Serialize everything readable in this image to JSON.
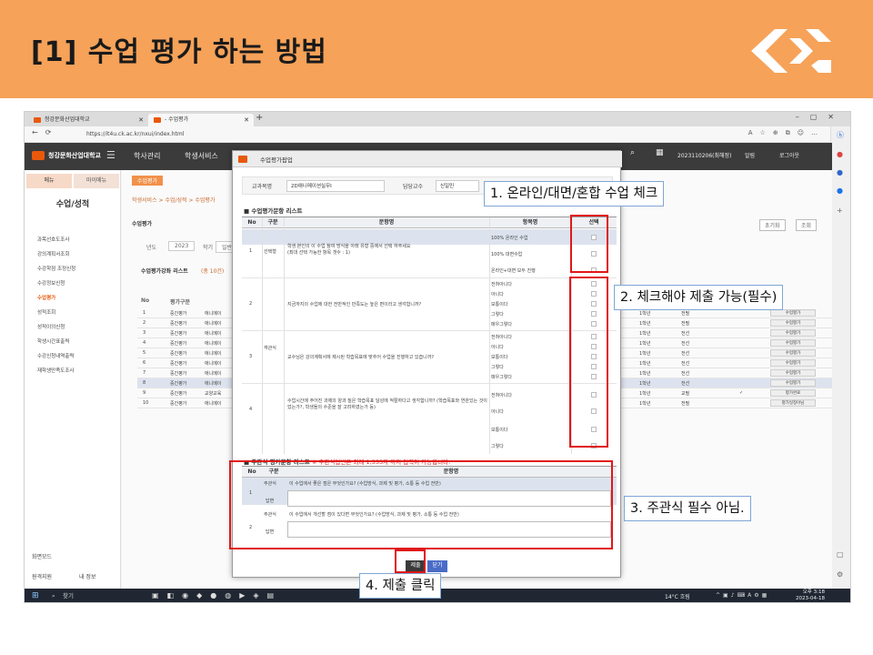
{
  "slide": {
    "title": "[1] 수업 평가 하는 방법"
  },
  "browser": {
    "tabs": [
      "청강문화산업대학교",
      "- 수업평가"
    ],
    "url": "https://it4u.ck.ac.kr/nxui/index.html"
  },
  "site": {
    "name": "청강문화산업대학교",
    "nav": [
      "학사관리",
      "학생서비스"
    ],
    "user": "2023110206(최해정)",
    "alarm": "알림",
    "logout": "로그아웃"
  },
  "leftpanel": {
    "tabs": [
      "메뉴",
      "마이메뉴"
    ],
    "section": "수업/성적",
    "items": [
      "과목선호도조사",
      "강의계획서조회",
      "수강학점 조정신청",
      "수강정보신청",
      "수업평가",
      "성적조회",
      "성적이의신청",
      "학생시간표출력",
      "수강신청내역출력",
      "재학생만족도조사"
    ],
    "bottom": [
      "화면모드",
      "원격지원",
      "내 정보"
    ]
  },
  "background": {
    "tab": "수업평가",
    "breadcrumb": "학생서비스 > 수업/성적 > 수업평가",
    "page_title": "수업평가",
    "year_label": "년도",
    "year_value": "2023",
    "term_label": "학기",
    "term_value": "일반",
    "list_title": "수업평가강좌 리스트",
    "list_count": "(총 10건)",
    "search_btn": "조회",
    "reset_btn": "초기화",
    "header_no": "No",
    "header_type": "평가구분",
    "rows": [
      {
        "no": "1",
        "type": "중간평가",
        "course": "애니메이",
        "grade": "1학년",
        "kind": "전필",
        "btn": "수업평가"
      },
      {
        "no": "2",
        "type": "중간평가",
        "course": "애니메이",
        "grade": "1학년",
        "kind": "전필",
        "btn": "수업평가"
      },
      {
        "no": "3",
        "type": "중간평가",
        "course": "애니메이",
        "grade": "1학년",
        "kind": "전선",
        "btn": "수업평가"
      },
      {
        "no": "4",
        "type": "중간평가",
        "course": "애니메이",
        "grade": "1학년",
        "kind": "전선",
        "btn": "수업평가"
      },
      {
        "no": "5",
        "type": "중간평가",
        "course": "애니메이",
        "grade": "1학년",
        "kind": "전선",
        "btn": "수업평가"
      },
      {
        "no": "6",
        "type": "중간평가",
        "course": "애니메이",
        "grade": "1학년",
        "kind": "전선",
        "btn": "수업평가"
      },
      {
        "no": "7",
        "type": "중간평가",
        "course": "애니메이",
        "grade": "1학년",
        "kind": "전선",
        "btn": "수업평가"
      },
      {
        "no": "8",
        "type": "중간평가",
        "course": "애니메이",
        "grade": "1학년",
        "kind": "전선",
        "btn": "수업평가"
      },
      {
        "no": "9",
        "type": "중간평가",
        "course": "교양교육",
        "grade": "1학년",
        "kind": "교필",
        "btn": "평가완료"
      },
      {
        "no": "10",
        "type": "중간평가",
        "course": "애니메이",
        "grade": "1학년",
        "kind": "전필",
        "btn": "평가일정아님"
      }
    ]
  },
  "popup": {
    "title": "수업평가팝업",
    "course_label": "교과목명",
    "course_value": "2D애니메이션실무Ⅰ",
    "prof_label": "담당교수",
    "prof_value": "신일민",
    "obj_title": "수업평가문항 리스트",
    "headers": {
      "no": "No",
      "type": "구분",
      "question": "문항명",
      "item": "항목명",
      "select": "선택"
    },
    "group_choice": "선택형",
    "group_obj": "객관식",
    "questions": [
      {
        "no": "1",
        "text": "학생 본인의 이 수업 참여 방식을 아래 유형 중에서 선택 하주세요",
        "sub": "(최대 선택 가능한 항목 갯수 : 1)",
        "options": [
          "100% 온라인 수업",
          "100% 대면수업",
          "온라인+대면 모두 진행"
        ]
      },
      {
        "no": "2",
        "text": "지금까지의 수업에 대한 전반적인 만족도는 높은 편이라고 생각합니까?",
        "sub": "",
        "options": [
          "전혀아니다",
          "아니다",
          "보통이다",
          "그렇다",
          "매우그렇다"
        ]
      },
      {
        "no": "3",
        "text": "교수님은 강의계획서에 제시된 학습목표에 맞추어 수업을 진행하고 있습니까?",
        "sub": "",
        "options": [
          "전혀아니다",
          "아니다",
          "보통이다",
          "그렇다",
          "매우그렇다"
        ]
      },
      {
        "no": "4",
        "text": "수업시간에 주어진 과제의 양과 질은 학습목표 달성에 적절하다고 생각합니까? (학습목표와 연관있는 것이었는가?, 학생들의 수준을 잘 고려하였는가 등)",
        "sub": "",
        "options": [
          "전혀아니다",
          "아니다",
          "보통이다",
          "그렇다"
        ]
      }
    ],
    "subj_title": "주관식 평가문항 리스트",
    "subj_note": "※ 주관식답변은 최대 1,333자 까지 입력이 가능합니다.",
    "subj_headers": {
      "no": "No",
      "type": "구분",
      "question": "문항명"
    },
    "subj": [
      {
        "no": "1",
        "type": "주관식",
        "answer_label": "답변",
        "text": "이 수업에서 좋은 점은 무엇인가요? (수업방식, 과제 및 평가, 소통 등 수업 전반)"
      },
      {
        "no": "2",
        "type": "주관식",
        "answer_label": "답변",
        "text": "이 수업에서 개선할 점이 있다면 무엇인가요? (수업방식, 과제 및 평가, 소통 등 수업 전반)"
      }
    ],
    "submit": "제출",
    "close": "닫기"
  },
  "taskbar": {
    "search": "찾기",
    "weather": "14°C 흐림",
    "time": "오후 3:18",
    "date": "2023-04-18"
  },
  "callouts": [
    "1. 온라인/대면/혼합 수업 체크",
    "2. 체크해야 제출 가능(필수)",
    "3. 주관식 필수 아님.",
    "4. 제출 클릭"
  ],
  "colors": {
    "header_bg": "#f6a259",
    "accent": "#e8590c",
    "callout_border": "#7fa6d6",
    "highlight_red": "#e01818"
  }
}
